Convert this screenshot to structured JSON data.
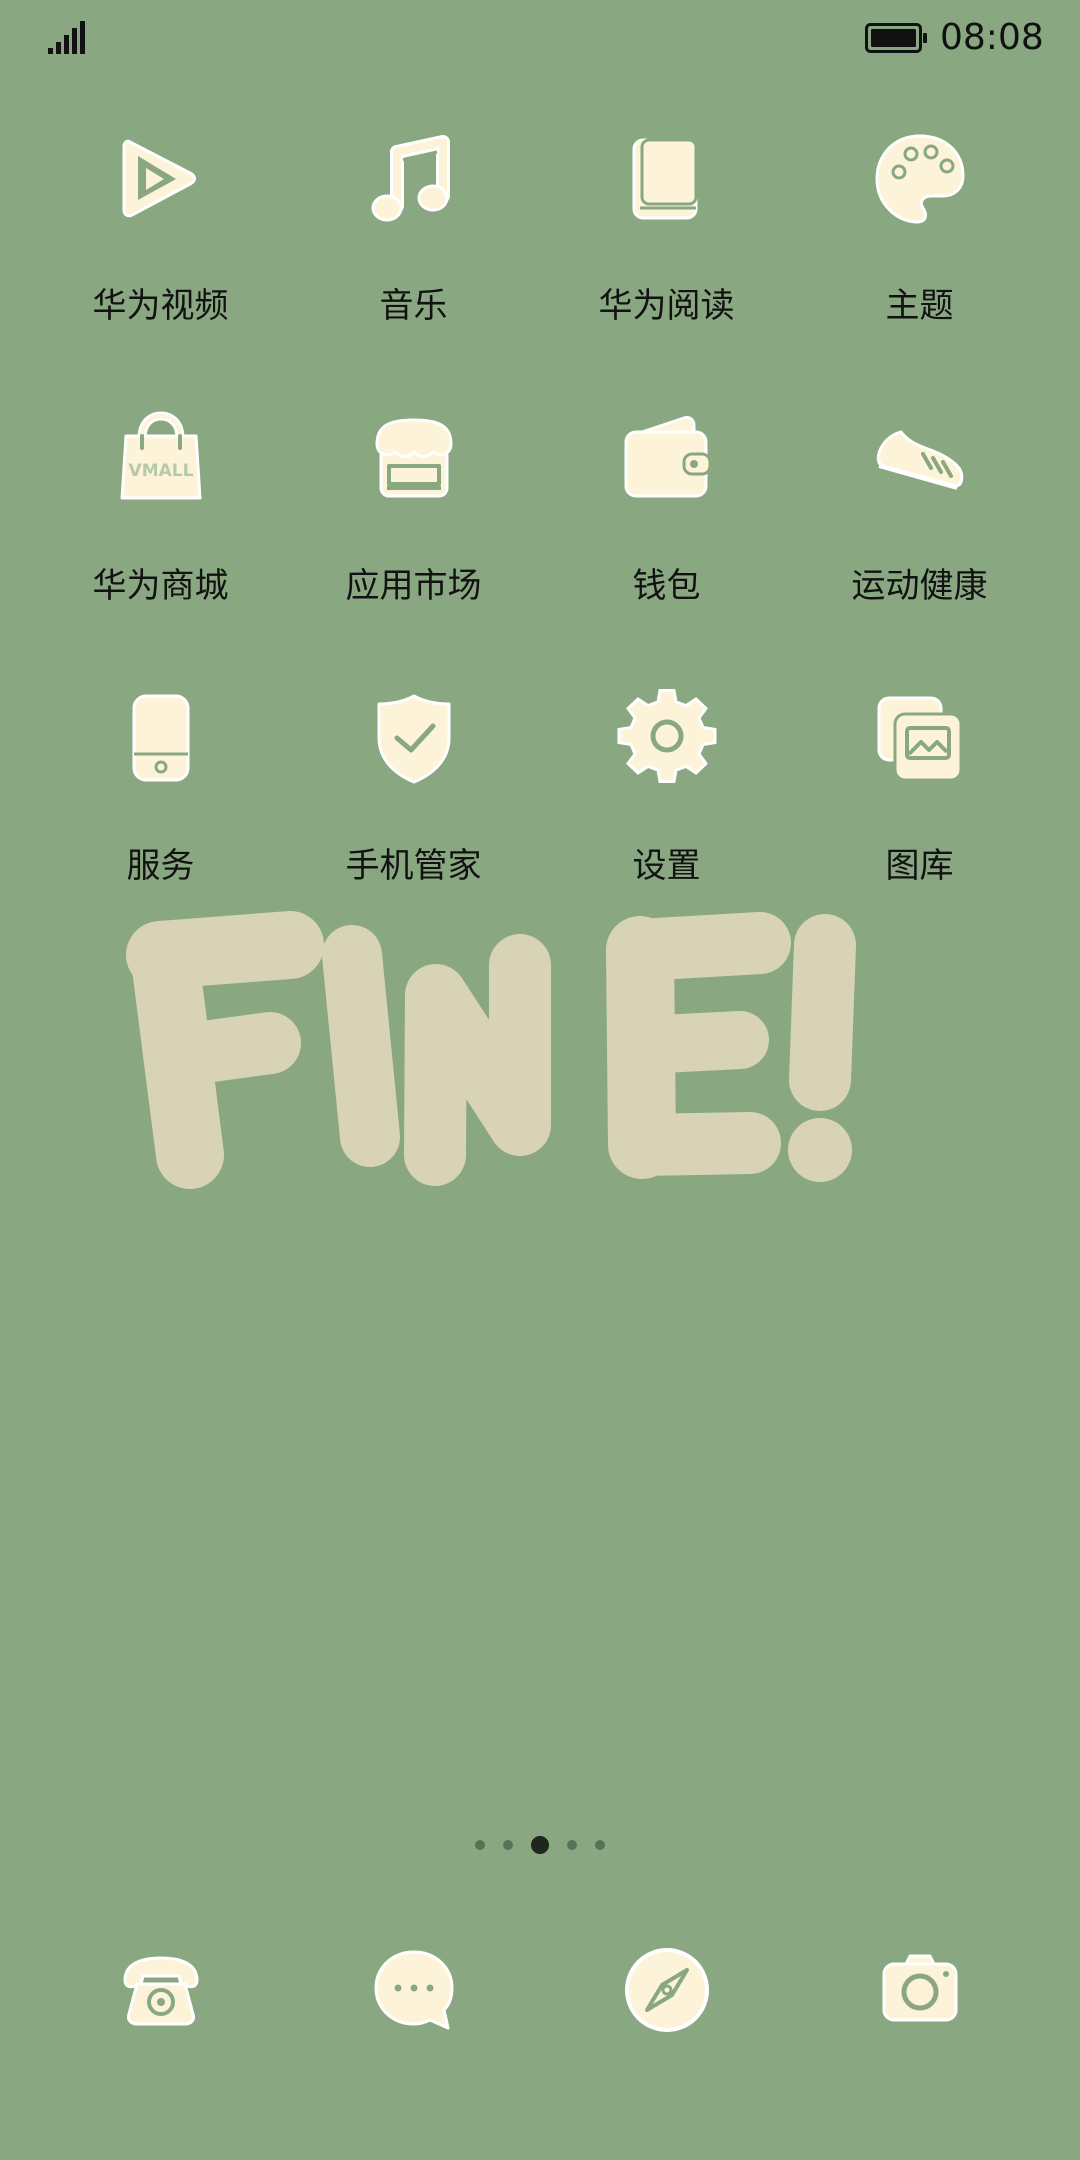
{
  "status_bar": {
    "time": "08:08",
    "signal_icon": "signal-bars-icon",
    "battery_icon": "battery-full-icon"
  },
  "colors": {
    "background": "#89a882",
    "icon_fill": "#fdf3d9",
    "icon_stroke": "#8aa882",
    "art": "#d8d3b4",
    "label": "#121212"
  },
  "apps": [
    {
      "label": "华为视频",
      "icon": "play-icon"
    },
    {
      "label": "音乐",
      "icon": "music-note-icon"
    },
    {
      "label": "华为阅读",
      "icon": "book-icon"
    },
    {
      "label": "主题",
      "icon": "palette-icon"
    },
    {
      "label": "华为商城",
      "icon": "shopping-bag-icon",
      "icon_text": "VMALL"
    },
    {
      "label": "应用市场",
      "icon": "store-icon"
    },
    {
      "label": "钱包",
      "icon": "wallet-icon"
    },
    {
      "label": "运动健康",
      "icon": "sneaker-icon"
    },
    {
      "label": "服务",
      "icon": "phone-device-icon"
    },
    {
      "label": "手机管家",
      "icon": "shield-check-icon"
    },
    {
      "label": "设置",
      "icon": "gear-icon"
    },
    {
      "label": "图库",
      "icon": "gallery-icon"
    }
  ],
  "wallpaper_text": "FINE!",
  "page_indicator": {
    "count": 5,
    "active_index": 2
  },
  "dock": [
    {
      "icon": "telephone-icon"
    },
    {
      "icon": "message-bubble-icon"
    },
    {
      "icon": "compass-icon"
    },
    {
      "icon": "camera-icon"
    }
  ]
}
